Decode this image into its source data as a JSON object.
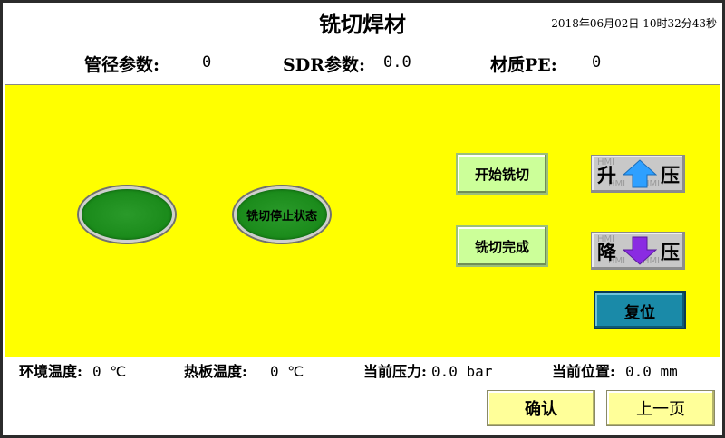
{
  "header": {
    "title": "铣切焊材",
    "datetime": "2018年06月02日  10时32分43秒",
    "pipe_label": "管径参数:",
    "pipe_value": "0",
    "sdr_label": "SDR参数:",
    "sdr_value": "0.0",
    "material_label": "材质PE:",
    "material_value": "0"
  },
  "panel": {
    "lamp_right_label": "铣切停止状态",
    "start_button": "开始铣切",
    "done_button": "铣切完成",
    "raise_left": "升",
    "raise_right": "压",
    "lower_left": "降",
    "lower_right": "压",
    "reset_button": "复位",
    "watermark": "HMI",
    "lamp_color": "#1a8a1a",
    "raise_arrow_color": "#2ea0ff",
    "lower_arrow_color": "#8a2be2"
  },
  "status": {
    "env_temp_label": "环境温度:",
    "env_temp_value": "0 ℃",
    "plate_temp_label": "热板温度:",
    "plate_temp_value": "0 ℃",
    "pressure_label": "当前压力:",
    "pressure_value": "0.0 bar",
    "position_label": "当前位置:",
    "position_value": "0.0 mm"
  },
  "footer": {
    "confirm_button": "确认",
    "prev_button": "上一页"
  }
}
